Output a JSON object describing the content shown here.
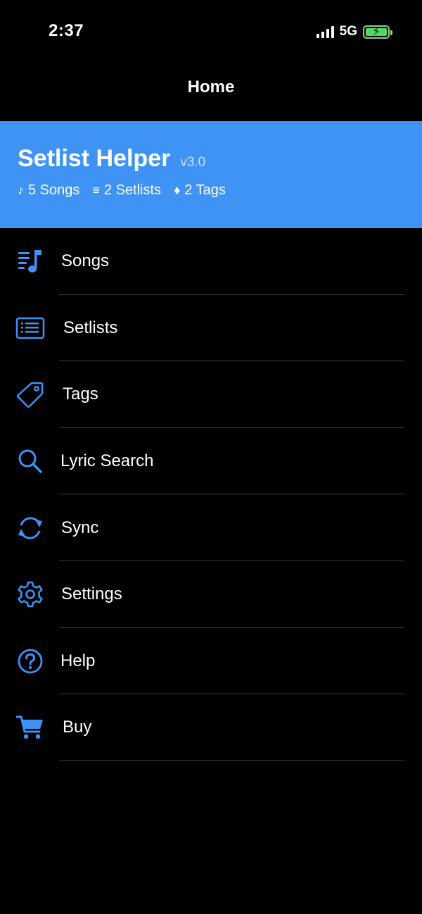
{
  "status_bar": {
    "time": "2:37",
    "network": "5G"
  },
  "nav": {
    "title": "Home"
  },
  "header": {
    "app_name": "Setlist Helper",
    "version": "v3.0",
    "stats": [
      {
        "glyph": "♪",
        "text": "5 Songs"
      },
      {
        "glyph": "≡",
        "text": "2 Setlists"
      },
      {
        "glyph": "♦",
        "text": "2 Tags"
      }
    ]
  },
  "menu": {
    "items": [
      {
        "label": "Songs",
        "icon": "music-list-icon"
      },
      {
        "label": "Setlists",
        "icon": "list-icon"
      },
      {
        "label": "Tags",
        "icon": "tag-icon"
      },
      {
        "label": "Lyric Search",
        "icon": "search-icon"
      },
      {
        "label": "Sync",
        "icon": "sync-icon"
      },
      {
        "label": "Settings",
        "icon": "gear-icon"
      },
      {
        "label": "Help",
        "icon": "help-icon"
      },
      {
        "label": "Buy",
        "icon": "cart-icon"
      }
    ]
  },
  "colors": {
    "accent": "#3e93f5",
    "icon": "#3e93f5",
    "background": "#000000"
  }
}
